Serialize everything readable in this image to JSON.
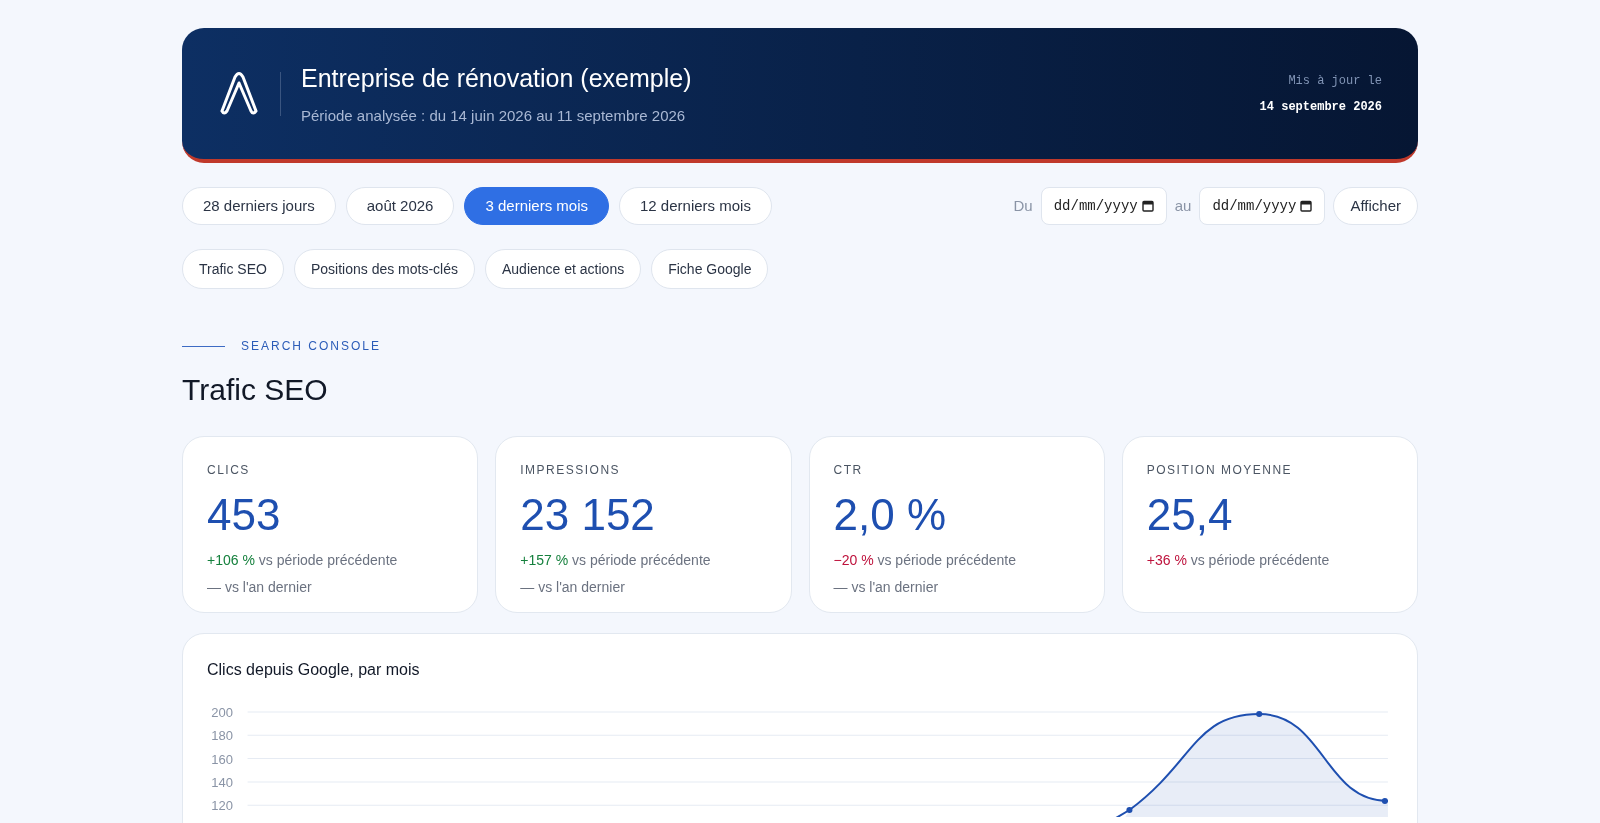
{
  "header": {
    "title": "Entreprise de rénovation (exemple)",
    "subtitle": "Période analysée : du 14 juin 2026 au 11 septembre 2026",
    "updated_label": "Mis à jour le",
    "updated_date": "14 septembre 2026"
  },
  "periods": [
    {
      "label": "28 derniers jours",
      "selected": false
    },
    {
      "label": "août 2026",
      "selected": false
    },
    {
      "label": "3 derniers mois",
      "selected": true
    },
    {
      "label": "12 derniers mois",
      "selected": false
    }
  ],
  "date_range": {
    "from_label": "Du",
    "from_placeholder": "dd/mm/yyyy",
    "to_label": "au",
    "to_placeholder": "dd/mm/yyyy",
    "button": "Afficher"
  },
  "sections_nav": [
    "Trafic SEO",
    "Positions des mots-clés",
    "Audience et actions",
    "Fiche Google"
  ],
  "section": {
    "eyebrow": "SEARCH CONSOLE",
    "title": "Trafic SEO"
  },
  "kpis": [
    {
      "label": "CLICS",
      "value": "453",
      "delta": "+106 %",
      "color": "#15803d",
      "delta_text": "vs période précédente",
      "yoy": "— vs l'an dernier"
    },
    {
      "label": "IMPRESSIONS",
      "value": "23 152",
      "delta": "+157 %",
      "color": "#15803d",
      "delta_text": "vs période précédente",
      "yoy": "— vs l'an dernier"
    },
    {
      "label": "CTR",
      "value": "2,0 %",
      "delta": "−20 %",
      "color": "#be123c",
      "delta_text": "vs période précédente",
      "yoy": "— vs l'an dernier"
    },
    {
      "label": "POSITION MOYENNE",
      "value": "25,4",
      "delta": "+36 %",
      "color": "#be123c",
      "delta_text": "vs période précédente"
    }
  ],
  "chart": {
    "title": "Clics depuis Google, par mois",
    "y_axis_labels": [
      "200",
      "180",
      "160",
      "140",
      "120"
    ]
  }
}
